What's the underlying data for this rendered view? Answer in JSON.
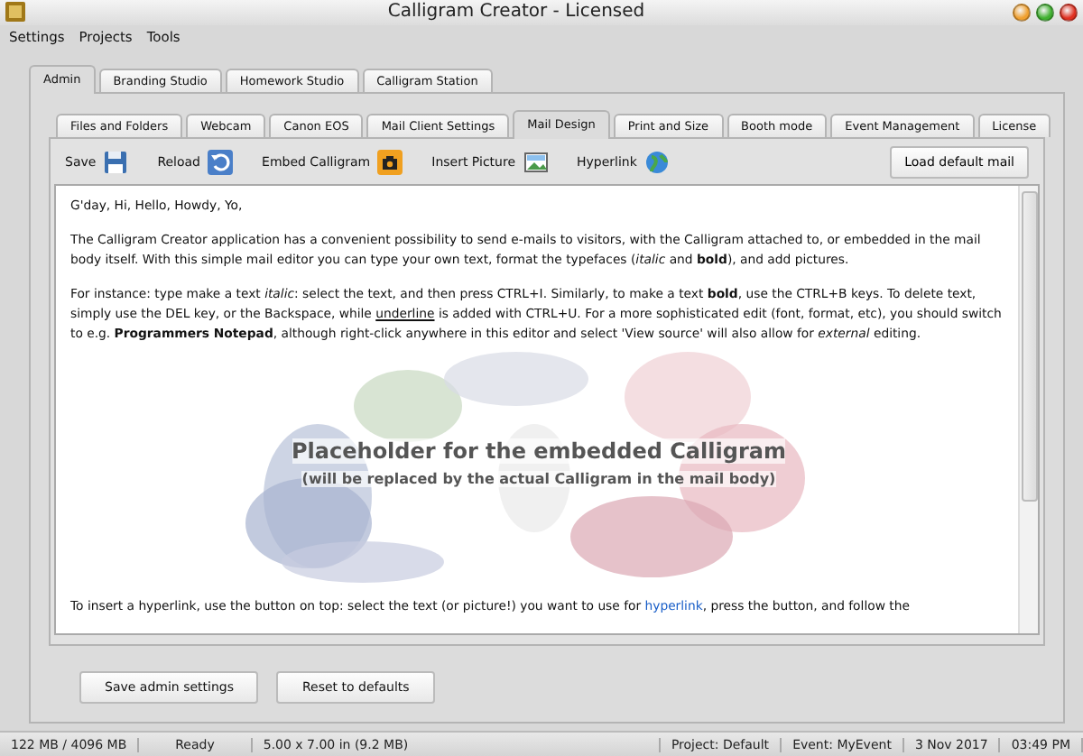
{
  "window": {
    "title": "Calligram Creator - Licensed"
  },
  "menu": [
    "Settings",
    "Projects",
    "Tools"
  ],
  "main_tabs": [
    {
      "label": "Admin",
      "selected": true
    },
    {
      "label": "Branding Studio",
      "selected": false
    },
    {
      "label": "Homework Studio",
      "selected": false
    },
    {
      "label": "Calligram Station",
      "selected": false
    }
  ],
  "sub_tabs": [
    {
      "label": "Files and Folders",
      "selected": false
    },
    {
      "label": "Webcam",
      "selected": false
    },
    {
      "label": "Canon EOS",
      "selected": false
    },
    {
      "label": "Mail Client Settings",
      "selected": false
    },
    {
      "label": "Mail Design",
      "selected": true
    },
    {
      "label": "Print and Size",
      "selected": false
    },
    {
      "label": "Booth mode",
      "selected": false
    },
    {
      "label": "Event Management",
      "selected": false
    },
    {
      "label": "License",
      "selected": false
    }
  ],
  "toolbar": [
    {
      "label": "Save",
      "kind": "save"
    },
    {
      "label": "Reload",
      "kind": "reload"
    },
    {
      "label": "Embed Calligram",
      "kind": "camera"
    },
    {
      "label": "Insert Picture",
      "kind": "picture"
    },
    {
      "label": "Hyperlink",
      "kind": "globe"
    }
  ],
  "load_button": "Load default mail",
  "editor": {
    "paragraphs": [
      [
        {
          "kind": "plain",
          "text": "G'day, Hi, Hello, Howdy, Yo,"
        }
      ],
      [
        {
          "kind": "plain",
          "text": "The Calligram Creator application has a convenient possibility to send e-mails to visitors, with the Calligram attached to, or embedded in the mail body itself. With this simple mail editor you can type your own text, format the typefaces (*italic* and **bold**), and add pictures."
        }
      ],
      [
        {
          "kind": "plain",
          "text": "For instance: type make a text *italic*: select the text, and then press CTRL+I. Similarly, to make a text **bold**, use the CTRL+B keys. To delete text, simply use the DEL key, or the Backspace, while "
        },
        {
          "kind": "underline",
          "text": "underline"
        },
        {
          "kind": "plain",
          "text": " is added with CTRL+U. For a more sophisticated edit (font, format, etc), you should switch to e.g. **Programmers Notepad**, although right-click anywhere in this editor and select 'View source' will also allow for *external* editing."
        }
      ],
      {
        "kind": "picture",
        "title": "Placeholder for the embedded Calligram",
        "subtitle": "(will be replaced by the actual Calligram in the mail body)"
      },
      [
        {
          "kind": "plain",
          "text": "To insert a hyperlink, use the button on top: select the text (or picture!) you want to use for "
        },
        {
          "kind": "link",
          "text": "hyperlink"
        },
        {
          "kind": "plain",
          "text": ", press the button, and follow the"
        }
      ]
    ]
  },
  "buttons": [
    "Save admin settings",
    "Reset to defaults"
  ],
  "status_bar": {
    "memory": "122 MB / 4096 MB",
    "state": "Ready",
    "size": "5.00 x 7.00 in  (9.2 MB)",
    "project": "Project: Default",
    "event": "Event: MyEvent",
    "date": "3 Nov 2017",
    "time": "03:49 PM"
  }
}
